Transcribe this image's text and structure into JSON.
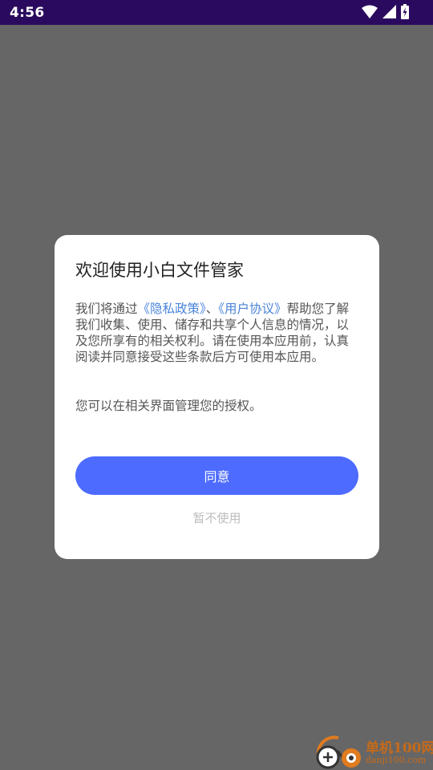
{
  "status_bar": {
    "time": "4:56",
    "icons": [
      "wifi-icon",
      "cellular-signal-icon",
      "battery-charging-icon"
    ],
    "background": "#2a0a5e"
  },
  "overlay_color": "#666666",
  "dialog": {
    "title": "欢迎使用小白文件管家",
    "body_prefix": "我们将通过",
    "privacy_link": "《隐私政策》",
    "separator": "、",
    "agreement_link": "《用户协议》",
    "body_suffix": "帮助您了解我们收集、使用、储存和共享个人信息的情况，以及您所享有的相关权利。请在使用本应用前，认真阅读并同意接受这些条款后方可使用本应用。",
    "note": "您可以在相关界面管理您的授权。",
    "agree_label": "同意",
    "decline_label": "暂不使用",
    "accent_color": "#4d6bfe",
    "link_color": "#4a84d9"
  },
  "watermark": {
    "name": "单机100网",
    "url": "danji100.com"
  }
}
